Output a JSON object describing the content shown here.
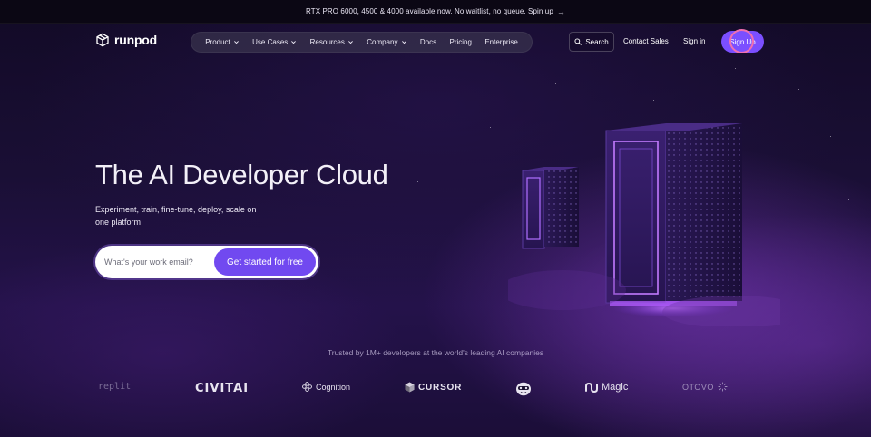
{
  "announcement": {
    "text": "RTX PRO 6000, 4500 & 4000 available now. No waitlist, no queue. Spin up",
    "arrow": "→"
  },
  "brand": {
    "name": "runpod"
  },
  "nav": {
    "items": [
      {
        "label": "Product",
        "has_dropdown": true
      },
      {
        "label": "Use Cases",
        "has_dropdown": true
      },
      {
        "label": "Resources",
        "has_dropdown": true
      },
      {
        "label": "Company",
        "has_dropdown": true
      },
      {
        "label": "Docs",
        "has_dropdown": false
      },
      {
        "label": "Pricing",
        "has_dropdown": false
      },
      {
        "label": "Enterprise",
        "has_dropdown": false
      }
    ],
    "search_label": "Search",
    "contact_label": "Contact Sales",
    "signin_label": "Sign in",
    "signup_label": "Sign Up"
  },
  "hero": {
    "title": "The AI Developer Cloud",
    "subtitle": "Experiment, train, fine-tune, deploy, scale on one platform",
    "email_placeholder": "What's your work email?",
    "cta_label": "Get started for free"
  },
  "trusted": {
    "text": "Trusted by 1M+ developers at the world's leading AI companies",
    "logos": [
      {
        "name": "replit",
        "label": "replit"
      },
      {
        "name": "civitai",
        "label": "CIVITAI"
      },
      {
        "name": "cognition",
        "label": "Cognition"
      },
      {
        "name": "cursor",
        "label": "CURSOR"
      },
      {
        "name": "mascot",
        "label": ""
      },
      {
        "name": "magic",
        "label": "Magic"
      },
      {
        "name": "otovo",
        "label": "OTOVO"
      }
    ]
  },
  "colors": {
    "accent": "#7b4fff",
    "cta": "#7149f0",
    "focus_ring": "#f070b0",
    "background_top": "#120a26",
    "background_bottom": "#24124a"
  },
  "icons": {
    "logo": "runpod-cube-logo",
    "search": "search-icon",
    "dropdown": "chevron-down-icon",
    "announcement_arrow": "arrow-right-icon"
  }
}
